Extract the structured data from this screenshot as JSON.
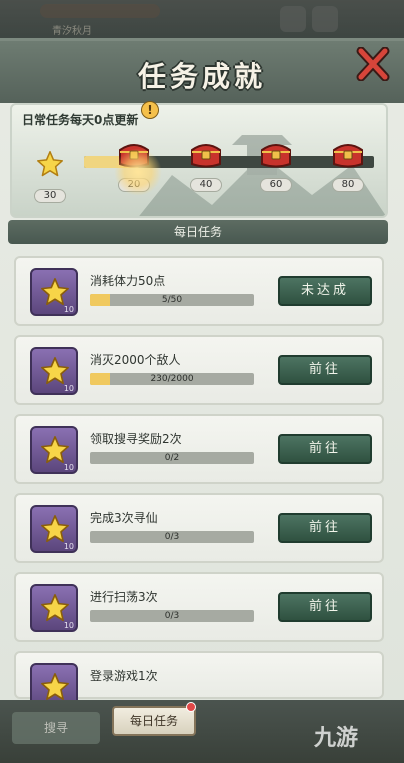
{
  "background": {
    "top_subtitle": "青汐秋月"
  },
  "panel": {
    "title": "任务成就",
    "close_icon": "close-x-icon"
  },
  "progress": {
    "title": "日常任务每天0点更新",
    "star_count": "30",
    "fill_fraction": 0.19,
    "milestones": [
      {
        "value": "20",
        "status": "claimable"
      },
      {
        "value": "40",
        "status": "locked"
      },
      {
        "value": "60",
        "status": "locked"
      },
      {
        "value": "80",
        "status": "locked"
      }
    ],
    "alert_mark": "!"
  },
  "section": {
    "title": "每日任务"
  },
  "tasks": [
    {
      "name": "消耗体力50点",
      "progress": "5/50",
      "fraction": 0.12,
      "button": "未达成",
      "reward": "10"
    },
    {
      "name": "消灭2000个敌人",
      "progress": "230/2000",
      "fraction": 0.12,
      "button": "前往",
      "reward": "10"
    },
    {
      "name": "领取搜寻奖励2次",
      "progress": "0/2",
      "fraction": 0,
      "button": "前往",
      "reward": "10"
    },
    {
      "name": "完成3次寻仙",
      "progress": "0/3",
      "fraction": 0,
      "button": "前往",
      "reward": "10"
    },
    {
      "name": "进行扫荡3次",
      "progress": "0/3",
      "fraction": 0,
      "button": "前往",
      "reward": "10"
    },
    {
      "name": "登录游戏1次",
      "progress": "",
      "fraction": 0,
      "button": "",
      "reward": "10"
    }
  ],
  "bottom": {
    "left_tab": "搜寻",
    "daily_tab": "每日任务"
  },
  "watermark": "九游",
  "colors": {
    "accent_green": "#2f5140",
    "progress_yellow": "#f0c95f",
    "chest_red": "#c8332c",
    "icon_purple": "#6b5590"
  }
}
